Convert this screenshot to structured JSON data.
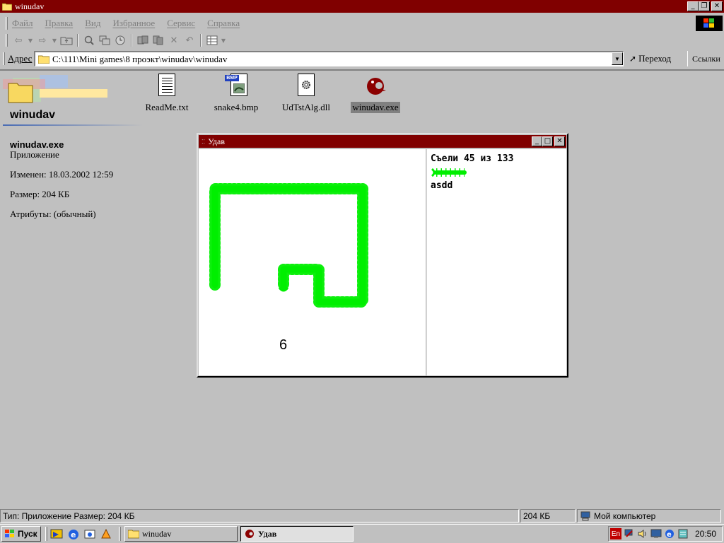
{
  "window": {
    "title": "winudav"
  },
  "menu": [
    "Файл",
    "Правка",
    "Вид",
    "Избранное",
    "Сервис",
    "Справка"
  ],
  "address": {
    "label": "Адрес",
    "path": "C:\\111\\Mini games\\8 проэкт\\winudav\\winudav",
    "go_label": "Переход",
    "links_label": "Ссылки"
  },
  "left_panel": {
    "folder_title": "winudav",
    "selected_name": "winudav.exe",
    "selected_type": "Приложение",
    "modified": "Изменен: 18.03.2002 12:59",
    "size": "Размер: 204 КБ",
    "attributes": "Атрибуты: (обычный)"
  },
  "files": [
    {
      "name": "ReadMe.txt",
      "icon": "text-file-icon"
    },
    {
      "name": "snake4.bmp",
      "icon": "bitmap-file-icon"
    },
    {
      "name": "UdTstAlg.dll",
      "icon": "dll-file-icon"
    },
    {
      "name": "winudav.exe",
      "icon": "snake-app-icon",
      "selected": true
    }
  ],
  "game": {
    "title": "Удав",
    "eaten": "Съели 45 из 133",
    "player": "asdd",
    "number": "6"
  },
  "status": {
    "type_size": "Тип: Приложение Размер: 204 КБ",
    "size": "204 КБ",
    "zone": "Мой компьютер"
  },
  "taskbar": {
    "start": "Пуск",
    "tasks": [
      {
        "label": "winudav"
      },
      {
        "label": "Удав",
        "active": true
      }
    ],
    "lang": "En",
    "clock": "20:50"
  },
  "colors": {
    "titlebar": "#800000",
    "face": "#c0c0c0",
    "snake": "#00ff00"
  }
}
